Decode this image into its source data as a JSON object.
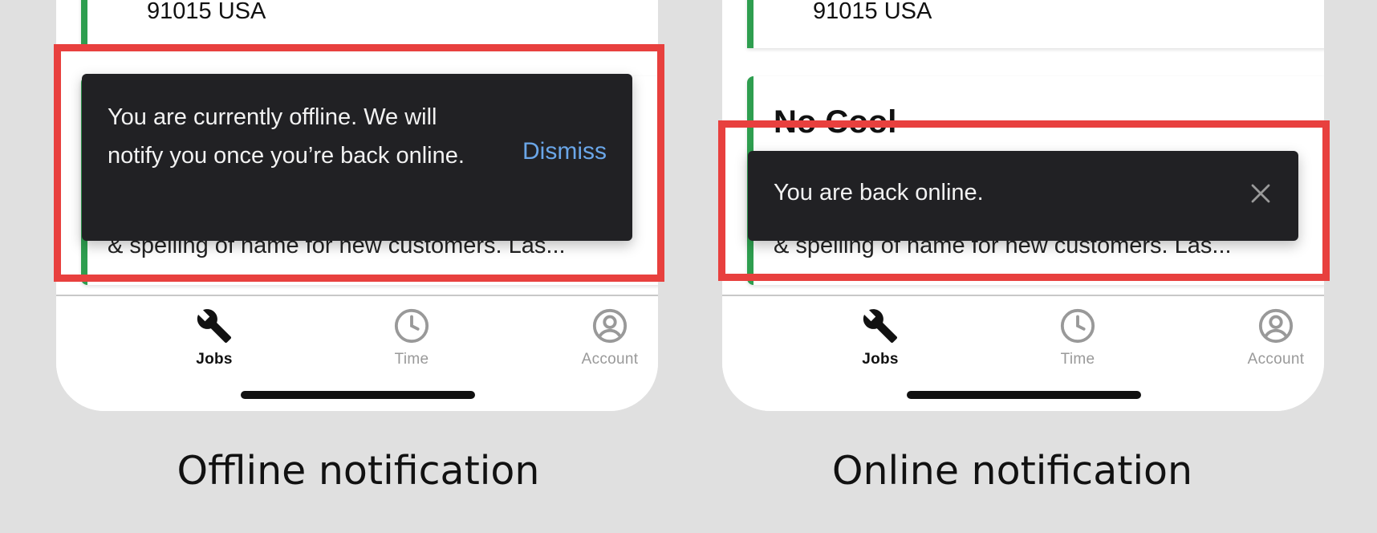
{
  "colors": {
    "background": "#e0e0e0",
    "toast_bg": "#212124",
    "dismiss_link": "#6aa6e8",
    "card_accent": "#2e9e4f",
    "highlight_frame": "#e8403e"
  },
  "panels": [
    {
      "card_address": "91015 USA",
      "card_title": "",
      "card_description": "& spelling of name for new customers. Las...",
      "toast": {
        "message": "You are currently offline. We will notify you once you’re back online.",
        "action_label": "Dismiss"
      },
      "caption": "Offline notification"
    },
    {
      "card_address": "91015 USA",
      "card_title": "No Cool",
      "card_description": "& spelling of name for new customers. Las...",
      "toast": {
        "message": "You are back online.",
        "action_icon": "close-icon"
      },
      "caption": "Online notification"
    }
  ],
  "tabbar": {
    "tabs": [
      {
        "label": "Jobs",
        "icon": "wrench-icon",
        "active": true
      },
      {
        "label": "Time",
        "icon": "clock-icon",
        "active": false
      },
      {
        "label": "Account",
        "icon": "account-icon",
        "active": false
      }
    ]
  }
}
